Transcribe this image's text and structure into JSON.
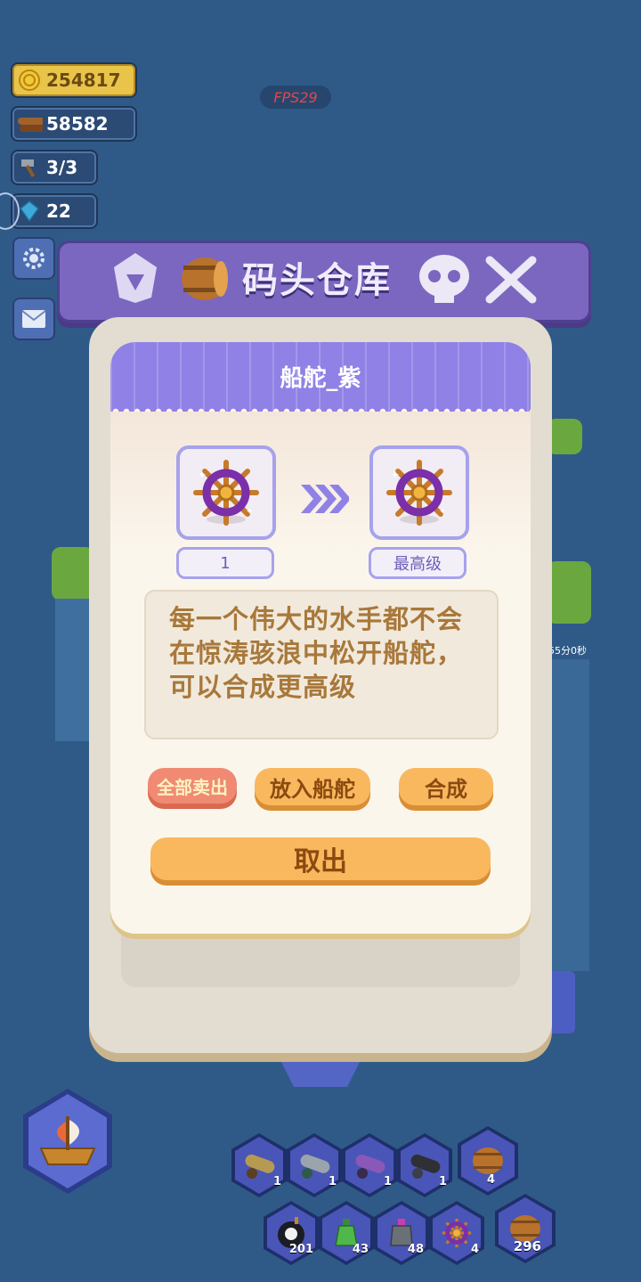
{
  "hud": {
    "coins": "254817",
    "wood": "58582",
    "hammer": "3/3",
    "gems": "22",
    "fps": "FPS29",
    "timer_text": "55分0秒"
  },
  "banner": {
    "title": "码头仓库"
  },
  "panel": {
    "item_name": "船舵_紫",
    "current_level": "1",
    "next_level": "最高级",
    "description": "每一个伟大的水手都不会在惊涛骇浪中松开船舵，可以合成更高级",
    "buttons": {
      "sell_all": "全部卖出",
      "place_wheel": "放入船舵",
      "merge": "合成",
      "take_out": "取出"
    }
  },
  "inventory": {
    "row1": [
      {
        "icon": "brass-cannon-icon",
        "count": "1"
      },
      {
        "icon": "silver-cannon-icon",
        "count": "1"
      },
      {
        "icon": "purple-cannon-icon",
        "count": "1"
      },
      {
        "icon": "black-cannon-icon",
        "count": "1"
      },
      {
        "icon": "barrel-icon",
        "count": "4"
      }
    ],
    "row2": [
      {
        "icon": "skull-bomb-icon",
        "count": "201"
      },
      {
        "icon": "green-potion-icon",
        "count": "43"
      },
      {
        "icon": "pink-potion-icon",
        "count": "48"
      },
      {
        "icon": "ship-wheel-icon",
        "count": "4"
      },
      {
        "icon": "barrel-icon",
        "count": "296"
      }
    ]
  },
  "colors": {
    "accent": "#8f81e6",
    "button_orange": "#f9b85e",
    "button_red": "#f08a73",
    "sea": "#2f5a87"
  }
}
